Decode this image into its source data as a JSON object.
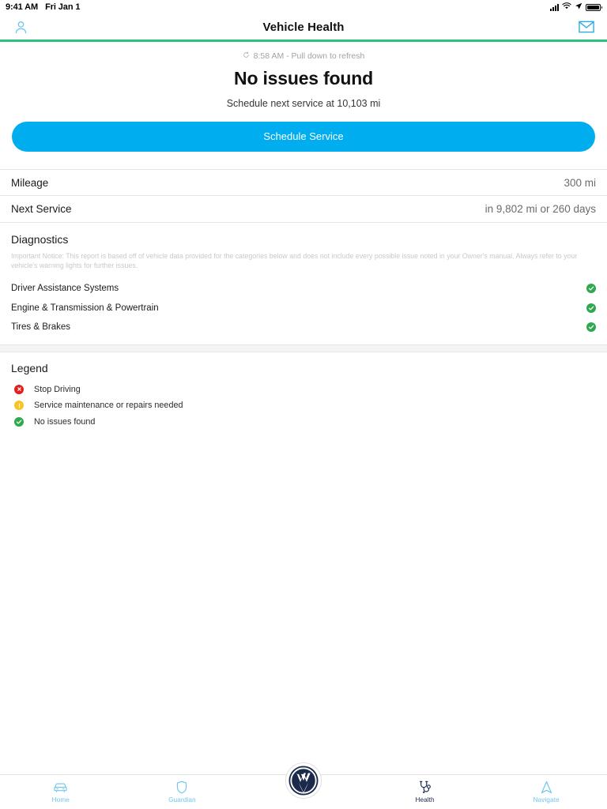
{
  "status_bar": {
    "time": "9:41 AM",
    "date": "Fri Jan 1",
    "icons": [
      "signal-bars-icon",
      "wifi-icon",
      "location-arrow-icon",
      "battery-icon"
    ]
  },
  "header": {
    "title": "Vehicle Health",
    "left_icon": "profile-icon",
    "right_icon": "mail-icon",
    "accent_color": "#2ec27e"
  },
  "hero": {
    "refresh_icon": "refresh-icon",
    "refresh_text": "8:58 AM - Pull down to refresh",
    "title": "No issues found",
    "subtitle": "Schedule next service at 10,103 mi"
  },
  "cta": {
    "label": "Schedule Service",
    "color": "#00aeef"
  },
  "info_rows": [
    {
      "key": "Mileage",
      "value": "300 mi"
    },
    {
      "key": "Next Service",
      "value": "in 9,802 mi or 260 days"
    }
  ],
  "diagnostics": {
    "title": "Diagnostics",
    "notice": "Important Notice: This report is based off of vehicle data provided for the categories below and does not include every possible issue noted in your Owner's manual.  Always refer to your vehicle's warning lights for further issues.",
    "items": [
      {
        "label": "Driver Assistance Systems",
        "status": "ok",
        "status_icon": "check-circle-icon"
      },
      {
        "label": "Engine & Transmission & Powertrain",
        "status": "ok",
        "status_icon": "check-circle-icon"
      },
      {
        "label": "Tires & Brakes",
        "status": "ok",
        "status_icon": "check-circle-icon"
      }
    ]
  },
  "legend": {
    "title": "Legend",
    "items": [
      {
        "label": "Stop Driving",
        "status": "stop",
        "status_icon": "x-circle-icon",
        "color": "#e02020"
      },
      {
        "label": "Service maintenance or repairs needed",
        "status": "warn",
        "status_icon": "exclamation-circle-icon",
        "color": "#f7c325"
      },
      {
        "label": "No issues found",
        "status": "ok",
        "status_icon": "check-circle-icon",
        "color": "#2fa84f"
      }
    ]
  },
  "tabbar": {
    "items": [
      {
        "label": "Home",
        "icon": "car-icon",
        "active": false
      },
      {
        "label": "Guardian",
        "icon": "shield-icon",
        "active": false
      },
      {
        "label": "",
        "icon": "vw-logo-icon",
        "active": false
      },
      {
        "label": "Health",
        "icon": "stethoscope-icon",
        "active": true
      },
      {
        "label": "Navigate",
        "icon": "navigate-arrow-icon",
        "active": false
      }
    ],
    "inactive_color": "#6ec6ef",
    "active_color": "#1b2a4a"
  }
}
